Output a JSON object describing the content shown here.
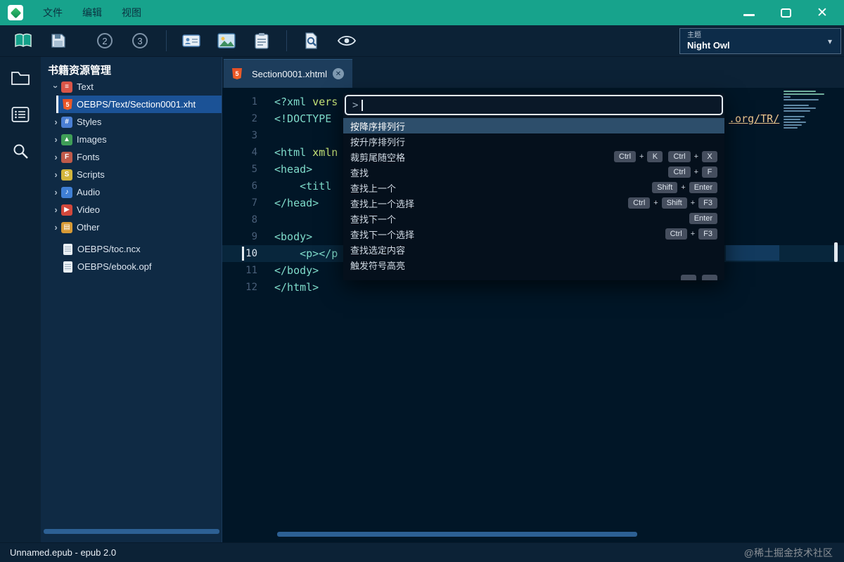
{
  "icons": {
    "chevron": "›",
    "caret_down": "▾",
    "close": "✕",
    "tab_close": "✕",
    "html5_glyph": "5"
  },
  "titlebar": {
    "menus": [
      {
        "label": "文件"
      },
      {
        "label": "编辑"
      },
      {
        "label": "视图"
      }
    ]
  },
  "toolbar": {
    "badge2": "2",
    "badge3": "3",
    "theme_label": "主题",
    "theme_value": "Night Owl"
  },
  "sidebar": {
    "title": "书籍资源管理",
    "items": [
      {
        "label": "Text",
        "icon": "text-folder-icon",
        "type": "glyph",
        "glyph": "≡",
        "color": "#d95548",
        "chevron": "expanded"
      },
      {
        "label": "OEBPS/Text/Section0001.xht",
        "icon": "html5-file-icon",
        "type": "html5",
        "selected": true
      },
      {
        "label": "Styles",
        "icon": "styles-folder-icon",
        "type": "glyph",
        "glyph": "#",
        "color": "#4a7fd4",
        "chevron": "collapsed"
      },
      {
        "label": "Images",
        "icon": "images-folder-icon",
        "type": "glyph",
        "glyph": "▲",
        "color": "#3f9e57",
        "chevron": "collapsed"
      },
      {
        "label": "Fonts",
        "icon": "fonts-folder-icon",
        "type": "glyph",
        "glyph": "F",
        "color": "#bf5a4a",
        "chevron": "collapsed"
      },
      {
        "label": "Scripts",
        "icon": "scripts-folder-icon",
        "type": "glyph",
        "glyph": "S",
        "color": "#d2b53c",
        "chevron": "collapsed"
      },
      {
        "label": "Audio",
        "icon": "audio-folder-icon",
        "type": "glyph",
        "glyph": "♪",
        "color": "#3f7fd4",
        "chevron": "collapsed"
      },
      {
        "label": "Video",
        "icon": "video-folder-icon",
        "type": "glyph",
        "glyph": "▶",
        "color": "#d2483c",
        "chevron": "collapsed"
      },
      {
        "label": "Other",
        "icon": "other-folder-icon",
        "type": "glyph",
        "glyph": "▤",
        "color": "#d79a36",
        "chevron": "collapsed"
      },
      {
        "label": "OEBPS/toc.ncx",
        "icon": "document-icon",
        "type": "doc",
        "gap": true
      },
      {
        "label": "OEBPS/ebook.opf",
        "icon": "document-icon",
        "type": "doc"
      }
    ]
  },
  "tabs": [
    {
      "label": "Section0001.xhtml"
    }
  ],
  "editor": {
    "doctype_link": ".org/TR/",
    "lines": [
      {
        "num": 1,
        "segs": [
          {
            "t": "<?xml",
            "c": "tag"
          },
          {
            "t": " vers",
            "c": "attr"
          }
        ]
      },
      {
        "num": 2,
        "segs": [
          {
            "t": "<!DOCTYPE",
            "c": "tag"
          }
        ]
      },
      {
        "num": 3,
        "segs": []
      },
      {
        "num": 4,
        "segs": [
          {
            "t": "<html",
            "c": "tag"
          },
          {
            "t": " xmln",
            "c": "attr"
          }
        ]
      },
      {
        "num": 5,
        "segs": [
          {
            "t": "<head>",
            "c": "tag"
          }
        ]
      },
      {
        "num": 6,
        "segs": [
          {
            "t": "    <titl",
            "c": "tag"
          }
        ]
      },
      {
        "num": 7,
        "segs": [
          {
            "t": "</head>",
            "c": "tag"
          }
        ]
      },
      {
        "num": 8,
        "segs": []
      },
      {
        "num": 9,
        "segs": [
          {
            "t": "<body>",
            "c": "tag"
          }
        ]
      },
      {
        "num": 10,
        "current": true,
        "segs": [
          {
            "t": "    <p></p",
            "c": "tag"
          }
        ]
      },
      {
        "num": 11,
        "segs": [
          {
            "t": "</body>",
            "c": "tag"
          }
        ]
      },
      {
        "num": 12,
        "segs": [
          {
            "t": "</html>",
            "c": "tag"
          }
        ]
      }
    ],
    "minimap_rows": [
      46,
      58,
      10,
      50,
      0,
      36,
      46,
      38,
      0,
      30,
      24,
      32,
      26,
      20
    ]
  },
  "palette": {
    "prompt": ">",
    "items": [
      {
        "label": "按降序排列行",
        "selected": true,
        "keys": []
      },
      {
        "label": "按升序排列行",
        "keys": []
      },
      {
        "label": "裁剪尾随空格",
        "keys": [
          [
            "Ctrl",
            "K"
          ],
          [
            "Ctrl",
            "X"
          ]
        ]
      },
      {
        "label": "查找",
        "keys": [
          [
            "Ctrl",
            "F"
          ]
        ]
      },
      {
        "label": "查找上一个",
        "keys": [
          [
            "Shift",
            "Enter"
          ]
        ]
      },
      {
        "label": "查找上一个选择",
        "keys": [
          [
            "Ctrl",
            "Shift",
            "F3"
          ]
        ]
      },
      {
        "label": "查找下一个",
        "keys": [
          [
            "Enter"
          ]
        ]
      },
      {
        "label": "查找下一个选择",
        "keys": [
          [
            "Ctrl",
            "F3"
          ]
        ]
      },
      {
        "label": "查找选定内容",
        "keys": []
      },
      {
        "label": "触发符号高亮",
        "keys": []
      },
      {
        "label": "",
        "keys": [
          [
            ""
          ],
          [
            ""
          ]
        ]
      }
    ]
  },
  "statusbar": {
    "left": "Unnamed.epub - epub 2.0",
    "watermark": "@稀土掘金技术社区"
  }
}
